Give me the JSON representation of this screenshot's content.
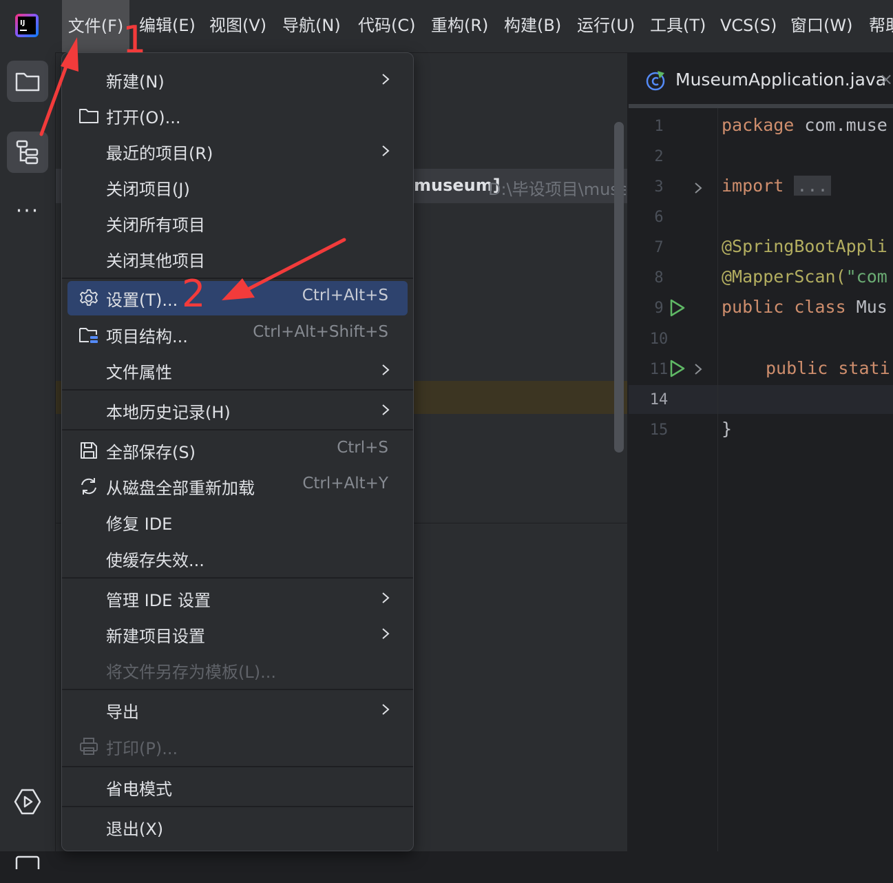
{
  "menubar": {
    "items": [
      "文件(F)",
      "编辑(E)",
      "视图(V)",
      "导航(N)",
      "代码(C)",
      "重构(R)",
      "构建(B)",
      "运行(U)",
      "工具(T)",
      "VCS(S)",
      "窗口(W)",
      "帮助"
    ]
  },
  "toolstrip": {
    "more": "···"
  },
  "project": {
    "root_name": "museum]",
    "root_path": "D:\\毕设项目\\muse"
  },
  "editor": {
    "tab_label": "MuseumApplication.java",
    "tab_close": "×",
    "line_numbers": [
      "1",
      "2",
      "3",
      "6",
      "7",
      "8",
      "9",
      "10",
      "11",
      "14",
      "15"
    ],
    "code": {
      "l1_kw": "package",
      "l1_rest": " com.muse",
      "l3_kw": "import",
      "l3_fold": "...",
      "l7": "@SpringBootAppli",
      "l8_ann": "@MapperScan(",
      "l8_str": "\"com",
      "l9_kw": "public class",
      "l9_rest": " Mus",
      "l11_kw": "public stati",
      "l15": "}"
    }
  },
  "file_menu": {
    "new": "新建(N)",
    "open": "打开(O)...",
    "recent": "最近的项目(R)",
    "close_project": "关闭项目(J)",
    "close_all": "关闭所有项目",
    "close_others": "关闭其他项目",
    "settings": "设置(T)...",
    "settings_shortcut": "Ctrl+Alt+S",
    "project_structure": "项目结构...",
    "project_structure_shortcut": "Ctrl+Alt+Shift+S",
    "file_properties": "文件属性",
    "local_history": "本地历史记录(H)",
    "save_all": "全部保存(S)",
    "save_all_shortcut": "Ctrl+S",
    "reload_all": "从磁盘全部重新加载",
    "reload_all_shortcut": "Ctrl+Alt+Y",
    "repair_ide": "修复 IDE",
    "invalidate_caches": "使缓存失效...",
    "manage_ide_settings": "管理 IDE 设置",
    "new_project_settings": "新建项目设置",
    "save_as_template": "将文件另存为模板(L)...",
    "export": "导出",
    "print": "打印(P)...",
    "power_save": "省电模式",
    "exit": "退出(X)"
  },
  "annotations": {
    "step1": "1",
    "step2": "2"
  },
  "colors": {
    "selection": "#2e436e",
    "annotation": "#f23b3b",
    "menu_bg": "#2b2d30"
  }
}
